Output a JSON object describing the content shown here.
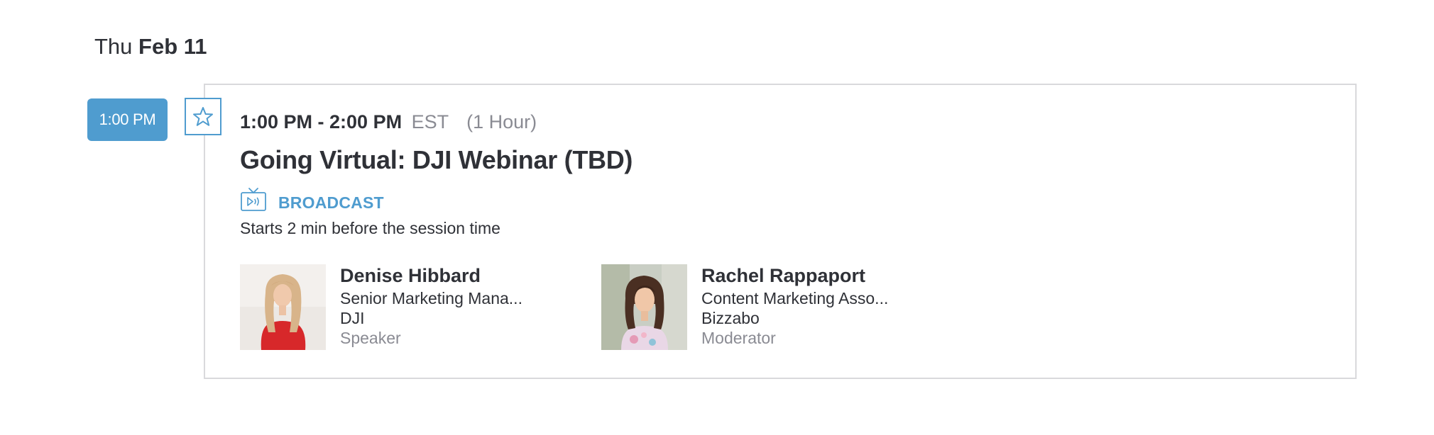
{
  "day": {
    "weekday": "Thu",
    "date": "Feb 11"
  },
  "time_slot": {
    "label": "1:00 PM"
  },
  "session": {
    "time_range": "1:00 PM - 2:00 PM",
    "timezone": "EST",
    "duration": "(1 Hour)",
    "title": "Going Virtual: DJI Webinar (TBD)",
    "format_label": "BROADCAST",
    "format_note": "Starts 2 min before the session time",
    "favorited": false
  },
  "people": [
    {
      "name": "Denise Hibbard",
      "title": "Senior Marketing Mana...",
      "company": "DJI",
      "role": "Speaker"
    },
    {
      "name": "Rachel Rappaport",
      "title": "Content Marketing Asso...",
      "company": "Bizzabo",
      "role": "Moderator"
    }
  ],
  "colors": {
    "accent": "#4f9ccf",
    "text": "#2f3137",
    "muted": "#8a8b93",
    "border": "#d9d9dc"
  },
  "icons": {
    "favorite": "star-outline-icon",
    "broadcast": "tv-broadcast-icon"
  }
}
